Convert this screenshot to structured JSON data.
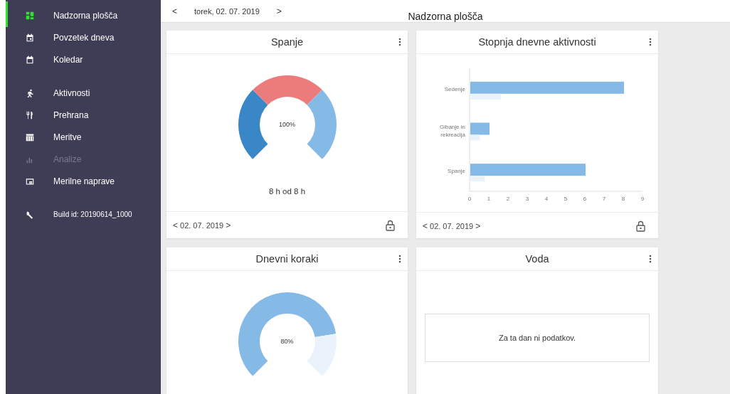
{
  "sidebar": {
    "groups": [
      [
        {
          "label": "Nadzorna plošča",
          "selected": true,
          "disabled": false
        },
        {
          "label": "Povzetek dneva",
          "selected": false,
          "disabled": false
        },
        {
          "label": "Koledar",
          "selected": false,
          "disabled": false
        }
      ],
      [
        {
          "label": "Aktivnosti",
          "selected": false,
          "disabled": false
        },
        {
          "label": "Prehrana",
          "selected": false,
          "disabled": false
        },
        {
          "label": "Meritve",
          "selected": false,
          "disabled": false
        },
        {
          "label": "Analize",
          "selected": false,
          "disabled": true
        },
        {
          "label": "Merilne naprave",
          "selected": false,
          "disabled": false
        }
      ]
    ],
    "build_id": "Build id: 20190614_1000"
  },
  "top_bar": {
    "prev": "<",
    "date": "torek, 02. 07. 2019",
    "next": ">",
    "title": "Nadzorna plošča"
  },
  "cards": [
    {
      "kind": "gauge",
      "title": "Spanje",
      "center_text": "100%",
      "caption": "8 h od 8 h",
      "segments": [
        {
          "color": "#3a87c8"
        },
        {
          "color": "#ec7c7c"
        },
        {
          "color": "#85b9e6"
        }
      ],
      "footer": {
        "prev": "<",
        "date": "02. 07. 2019",
        "next": ">"
      }
    },
    {
      "kind": "bar",
      "title": "Stopnja dnevne aktivnosti",
      "chart_data": {
        "type": "bar",
        "orientation": "horizontal",
        "categories": [
          "Sedenje",
          "Gibanje in rekreacija",
          "Spanje"
        ],
        "series": [
          {
            "color": "#85b9e6",
            "values": [
              8,
              1,
              6
            ]
          },
          {
            "color": "#eaf2fb",
            "values": [
              1.6,
              0.5,
              0.75
            ]
          }
        ],
        "xlim": [
          0,
          9
        ],
        "xticks": [
          0,
          1,
          2,
          3,
          4,
          5,
          6,
          7,
          8,
          9
        ]
      },
      "footer": {
        "prev": "<",
        "date": "02. 07. 2019",
        "next": ">"
      }
    },
    {
      "kind": "donut",
      "title": "Dnevni koraki",
      "center_text": "80%",
      "chart_data": {
        "type": "donut",
        "values": [
          80,
          20
        ]
      }
    },
    {
      "kind": "empty",
      "title": "Voda",
      "message": "Za ta dan ni podatkov."
    }
  ]
}
